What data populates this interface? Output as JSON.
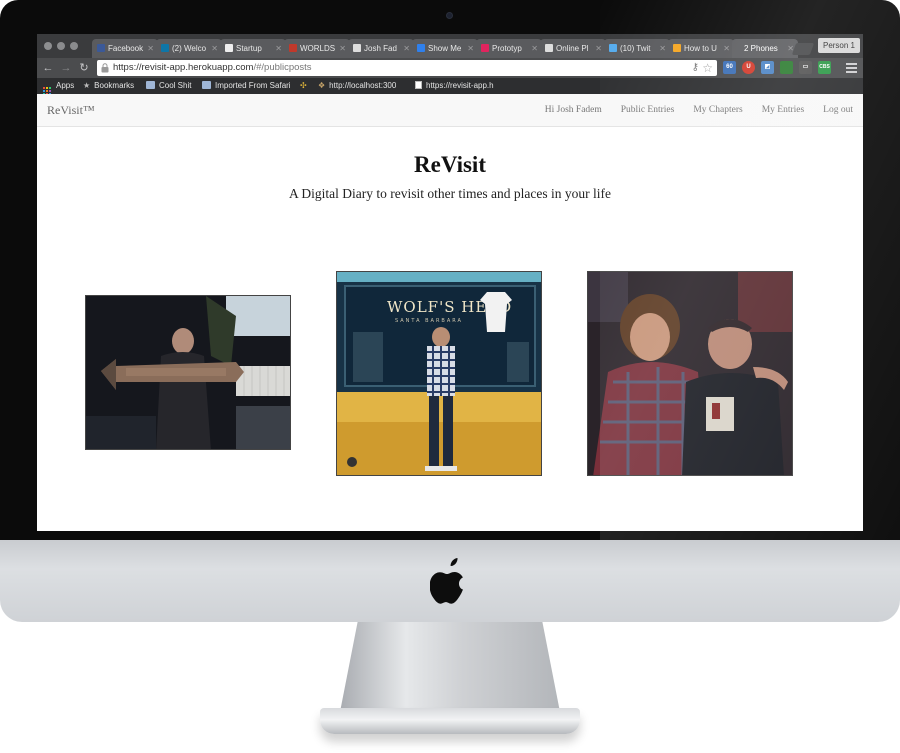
{
  "browser": {
    "tabs": [
      {
        "label": "Facebook",
        "favicon": "facebook-icon",
        "color": "#3b5998"
      },
      {
        "label": "(2) Welco",
        "favicon": "linkedin-icon",
        "color": "#0e76a8"
      },
      {
        "label": "Startup",
        "favicon": "startup-icon",
        "color": "#ffffff"
      },
      {
        "label": "WORLDS",
        "favicon": "worlds-icon",
        "color": "#c0392b"
      },
      {
        "label": "Josh Fad",
        "favicon": "page-icon",
        "color": "#dddddd"
      },
      {
        "label": "Show Me",
        "favicon": "stack-icon",
        "color": "#2f80ed"
      },
      {
        "label": "Prototyp",
        "favicon": "invision-icon",
        "color": "#e0245e"
      },
      {
        "label": "Online Pl",
        "favicon": "page-icon",
        "color": "#dddddd"
      },
      {
        "label": "(10) Twit",
        "favicon": "twitter-icon",
        "color": "#55acee"
      },
      {
        "label": "How to U",
        "favicon": "bolt-icon",
        "color": "#f5a623"
      },
      {
        "label": "2 Phones",
        "favicon": "",
        "color": ""
      }
    ],
    "profile_label": "Person 1",
    "url_host": "https://revisit-app.herokuapp.com",
    "url_path": "/#/publicposts",
    "bookmarks": [
      {
        "label": "Apps",
        "icon": "apps-grid-icon"
      },
      {
        "label": "Bookmarks",
        "icon": "star-icon"
      },
      {
        "label": "Cool Shit",
        "icon": "folder-icon"
      },
      {
        "label": "Imported From Safari",
        "icon": "folder-icon"
      },
      {
        "label": "",
        "icon": "pinwheel-icon"
      },
      {
        "label": "http://localhost:300",
        "icon": "localhost-icon"
      },
      {
        "label": "https://revisit-app.h",
        "icon": "page-icon"
      }
    ]
  },
  "site": {
    "brand": "ReVisit™",
    "nav": {
      "greeting": "Hi Josh Fadem",
      "public_entries": "Public Entries",
      "my_chapters": "My Chapters",
      "my_entries": "My Entries",
      "logout": "Log out"
    },
    "title": "ReVisit",
    "subtitle": "A Digital Diary to revisit other times and places in your life",
    "posts": [
      {
        "alt": "public post photo 1"
      },
      {
        "alt": "public post photo 2",
        "sign_text": "WOLF'S HEAD",
        "sign_small": "SANTA BARBARA"
      },
      {
        "alt": "public post photo 3"
      }
    ]
  },
  "colors": {
    "navbar_bg": "#f8f8f8",
    "nav_text": "#777777",
    "title_text": "#111111"
  }
}
